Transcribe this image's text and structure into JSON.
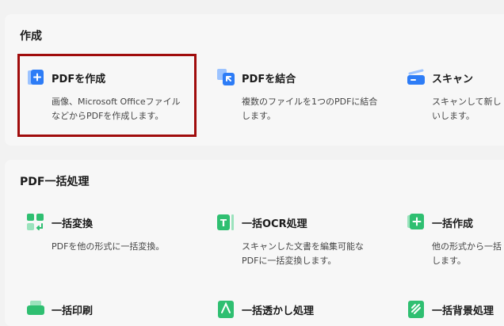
{
  "create": {
    "title": "作成",
    "items": [
      {
        "title": "PDFを作成",
        "desc": "画像、Microsoft Officeファイルなどから​PDFを作成します。",
        "icon": "create-pdf-icon"
      },
      {
        "title": "PDFを結合",
        "desc": "複数のファイルを1つのPDFに結合します。",
        "icon": "merge-pdf-icon"
      },
      {
        "title": "スキャン",
        "desc": "スキャンして新しい​します。",
        "icon": "scanner-icon"
      }
    ]
  },
  "batch": {
    "title": "PDF一括処理",
    "items": [
      {
        "title": "一括変換",
        "desc": "PDFを他の形式に一括変換。",
        "icon": "batch-convert-icon"
      },
      {
        "title": "一括OCR処理",
        "desc": "スキャンした文書を編集可能なPDFに一括変換します。",
        "icon": "batch-ocr-icon"
      },
      {
        "title": "一括作成",
        "desc": "他の形式から一括​します。",
        "icon": "batch-create-icon"
      },
      {
        "title": "一括印刷",
        "desc": "",
        "icon": "batch-print-icon"
      },
      {
        "title": "一括透かし処理",
        "desc": "",
        "icon": "batch-watermark-icon"
      },
      {
        "title": "一括背景処理",
        "desc": "",
        "icon": "batch-background-icon"
      }
    ]
  },
  "colors": {
    "accent": "#2d7cf6",
    "green": "#2fbf71",
    "selection": "#a00c0c"
  }
}
